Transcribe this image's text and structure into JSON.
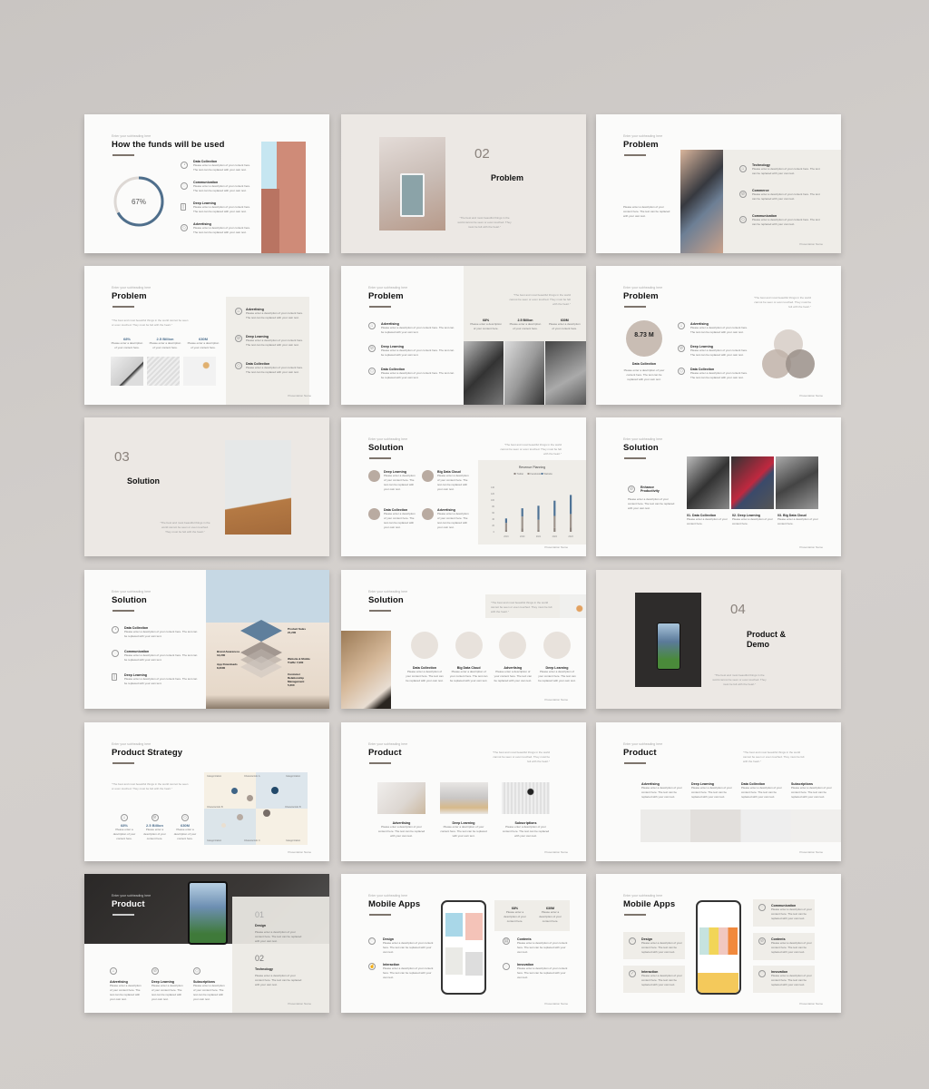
{
  "common": {
    "subheading": "Enter your subheading here",
    "footer": "Presentation Name",
    "body": "Please enter a description of your content here. The text can be replaced with your own text.",
    "short_body": "Please enter a description of your content here.",
    "quote": "\"The best and most beautiful things in the world cannot be seen or even touched. They must be felt with the heart.\""
  },
  "slides": [
    {
      "title": "How the funds will be used",
      "donut_value": "67%",
      "donut_fraction": 0.67,
      "items": [
        "Data Collection",
        "Communication",
        "Deep Learning",
        "Advertising"
      ]
    },
    {
      "number": "02",
      "title": "Problem"
    },
    {
      "title": "Problem",
      "items": [
        "Technology",
        "Commerce",
        "Communication"
      ]
    },
    {
      "title": "Problem",
      "stats": [
        "68%",
        "2.5 Billion",
        "630M"
      ],
      "items": [
        "Advertising",
        "Deep Learning",
        "Data Collection"
      ]
    },
    {
      "title": "Problem",
      "stats": [
        "68%",
        "2.5 Billion",
        "630M"
      ],
      "items": [
        "Advertising",
        "Deep Learning",
        "Data Collection"
      ]
    },
    {
      "title": "Problem",
      "circle_value": "8.73 M",
      "circle_label": "Data Collection",
      "items": [
        "Advertising",
        "Deep Learning",
        "Data Collection"
      ]
    },
    {
      "number": "03",
      "title": "Solution"
    },
    {
      "title": "Solution",
      "items": [
        "Deep Learning",
        "Big Data Cloud",
        "Data Collection",
        "Advertising"
      ]
    },
    {
      "title": "Solution",
      "lead": "Enhance Productivity",
      "items": [
        "01. Data Collection",
        "02. Deep Learning",
        "03. Big Data Cloud"
      ]
    },
    {
      "title": "Solution",
      "items": [
        "Data Collection",
        "Communication",
        "Deep Learning"
      ],
      "funnel": [
        "Product Sales 21,200",
        "Brand Awareness 12,200",
        "App Downloads 8,2000",
        "Website & Mobile Traffic 7,900",
        "Customer Relationship Management 5,200"
      ]
    },
    {
      "title": "Solution",
      "items": [
        "Data Collection",
        "Big Data Cloud",
        "Advertising",
        "Deep Learning"
      ]
    },
    {
      "number": "04",
      "title": "Product & Demo"
    },
    {
      "title": "Product Strategy",
      "stats": [
        "68%",
        "2.5 Billion",
        "630M"
      ],
      "matrix_labels": [
        "Categorization",
        "Characteristic A",
        "Categorization",
        "Characteristic B",
        "Characteristic B",
        "Categorization",
        "Characteristic C",
        "Categorization"
      ]
    },
    {
      "title": "Product",
      "items": [
        "Advertising",
        "Deep Learning",
        "Subscriptions"
      ]
    },
    {
      "title": "Product",
      "items": [
        "Advertising",
        "Deep Learning",
        "Data Collection",
        "Subscriptions"
      ]
    },
    {
      "title": "Product",
      "items": [
        "Advertising",
        "Deep Learning",
        "Subscriptions"
      ],
      "steps": [
        {
          "n": "01",
          "label": "Design"
        },
        {
          "n": "02",
          "label": "Technology"
        }
      ]
    },
    {
      "title": "Mobile Apps",
      "stats": [
        "68%",
        "630M"
      ],
      "items": [
        "Design",
        "Interaction",
        "Contents",
        "Innovation"
      ]
    },
    {
      "title": "Mobile Apps",
      "items": [
        "Design",
        "Interaction",
        "Communication",
        "Contents",
        "Innovation"
      ]
    }
  ],
  "chart_data": {
    "type": "bar",
    "title": "Revenue Planning",
    "legend": [
      "Twitter",
      "Facebook",
      "Website"
    ],
    "legend_position": "top",
    "categories": [
      "2019",
      "2020",
      "2021",
      "2022",
      "2023"
    ],
    "series": [
      {
        "name": "Twitter",
        "values": [
          8,
          10,
          8,
          12,
          14
        ]
      },
      {
        "name": "Facebook",
        "values": [
          20,
          38,
          30,
          38,
          42
        ]
      },
      {
        "name": "Website",
        "values": [
          14,
          26,
          44,
          48,
          60
        ]
      }
    ],
    "yticks": [
      0,
      20,
      40,
      60,
      80,
      100,
      120,
      140
    ],
    "ylim": [
      0,
      140
    ],
    "colors": [
      "#8e857f",
      "#9e948d",
      "#4f7396"
    ]
  }
}
